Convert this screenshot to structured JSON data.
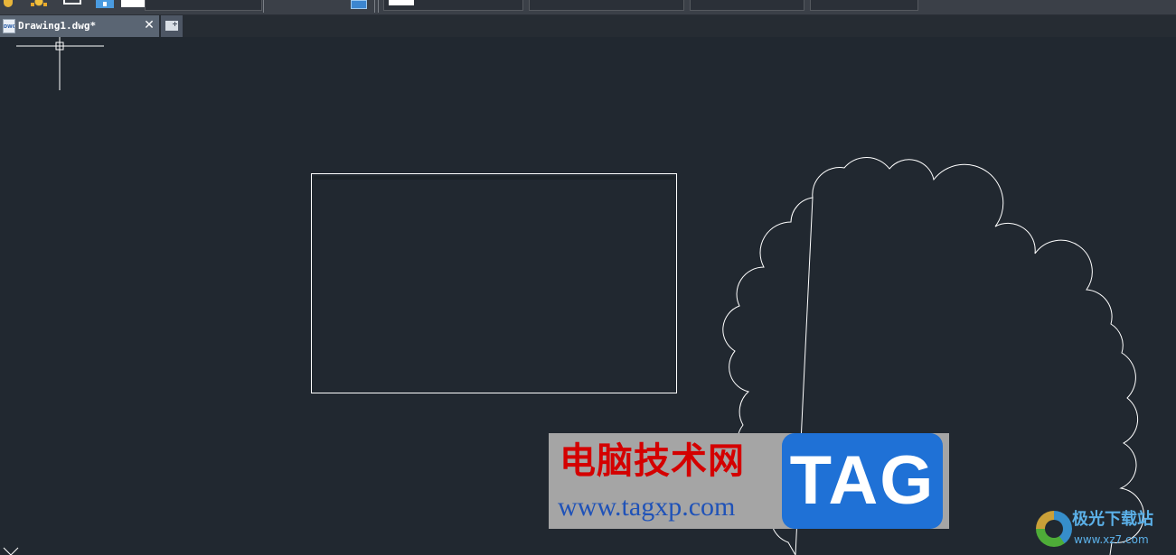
{
  "app": {
    "document_tab": {
      "title": "Drawing1.dwg*",
      "icon_text": "DWG",
      "close_glyph": "✕"
    },
    "new_tab_icon": "new-tab-icon"
  },
  "toolbar": {
    "icons": [
      "lightbulb-icon",
      "sun-icon",
      "square-icon",
      "layer-icon",
      "triangle-icon",
      "triangle-icon",
      "calculator-icon"
    ]
  },
  "canvas": {
    "background": "#212830",
    "entities": [
      "rectangle",
      "revision-cloud",
      "crosshair-cursor",
      "ucs-icon"
    ],
    "line_color": "#ffffff"
  },
  "watermark": {
    "chinese_text": "电脑技术网",
    "url": "www.tagxp.com",
    "tag_text": "TAG",
    "site_name": "极光下载站",
    "site_url": "www.xz7.com"
  }
}
